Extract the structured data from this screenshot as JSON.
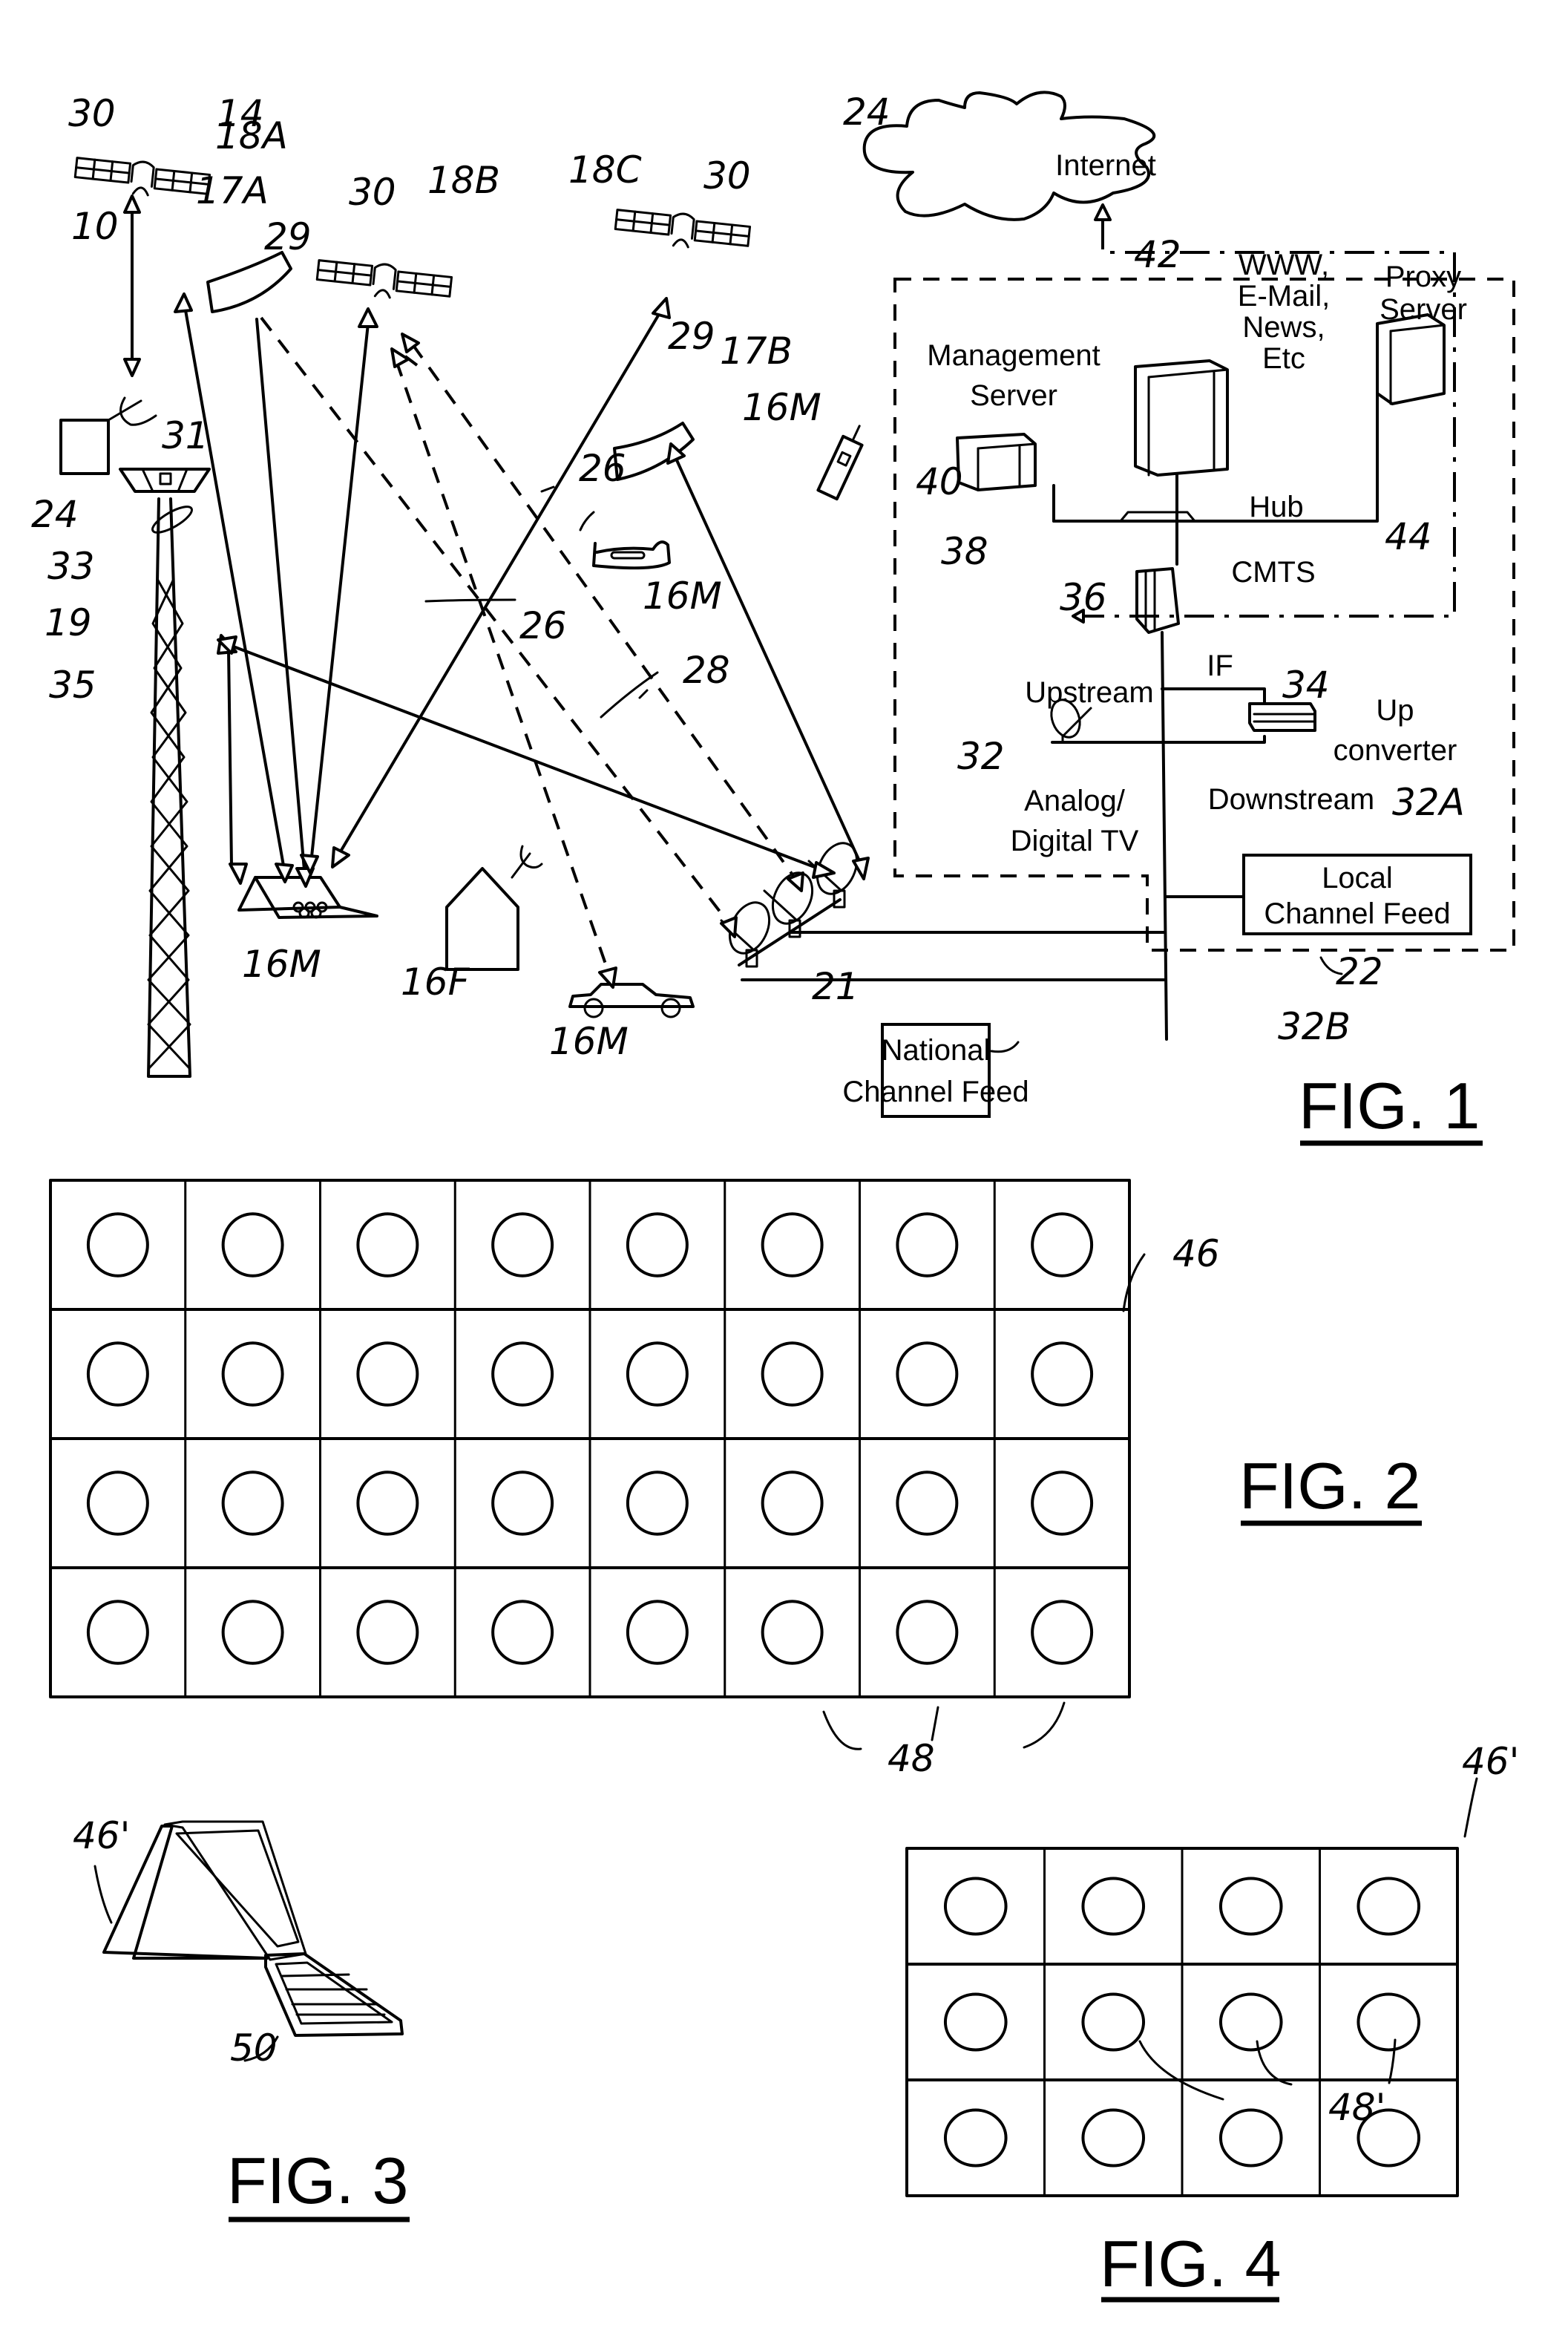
{
  "figures": {
    "fig1": {
      "caption": "FIG. 1",
      "text_labels": {
        "internet": "Internet",
        "management_server_1": "Management",
        "management_server_2": "Server",
        "www_1": "WWW,",
        "www_2": "E-Mail,",
        "www_3": "News,",
        "www_4": "Etc",
        "proxy_1": "Proxy",
        "proxy_2": "Server",
        "hub": "Hub",
        "cmts": "CMTS",
        "if": "IF",
        "upstream": "Upstream",
        "up_converter_1": "Up",
        "up_converter_2": "converter",
        "downstream": "Downstream",
        "analog_tv_1": "Analog/",
        "analog_tv_2": "Digital TV",
        "local_feed_1": "Local",
        "local_feed_2": "Channel Feed",
        "national_feed_1": "National",
        "national_feed_2": "Channel Feed"
      },
      "reference_numerals": {
        "sat_18a_antenna": "30",
        "system_14": "14",
        "sat_18a": "18A",
        "system_10": "10",
        "sat_17a": "17A",
        "spot_29a": "29",
        "sat_18b_antenna": "30",
        "sat_18b": "18B",
        "sat_18c": "18C",
        "sat_18c_antenna": "30",
        "spot_29b": "29",
        "sat_17b": "17B",
        "phone_16m": "16M",
        "link_26a": "26",
        "plane_16m": "16M",
        "internet_24_left": "24",
        "tower_31": "31",
        "tower_33": "33",
        "tower_19": "19",
        "tower_35": "35",
        "link_26b": "26",
        "link_26c": "26",
        "link_28": "28",
        "laptop_16m": "16M",
        "house_16f": "16F",
        "car_16m": "16M",
        "dishes_21": "21",
        "internet_24": "24",
        "server_42": "42",
        "mgmt_40": "40",
        "hub_38": "38",
        "proxy_44": "44",
        "cmts_36": "36",
        "upconv_34": "34",
        "dish_32": "32",
        "local_32a": "32A",
        "gateway_22": "22",
        "national_32b": "32B"
      }
    },
    "fig2": {
      "caption": "FIG. 2",
      "panel_ref": "46",
      "element_ref": "48",
      "grid": {
        "rows": 4,
        "cols": 8
      }
    },
    "fig3": {
      "caption": "FIG. 3",
      "panel_ref": "46'",
      "laptop_ref": "50"
    },
    "fig4": {
      "caption": "FIG. 4",
      "panel_ref": "46'",
      "element_ref": "48'",
      "grid": {
        "rows": 3,
        "cols": 4
      }
    }
  }
}
